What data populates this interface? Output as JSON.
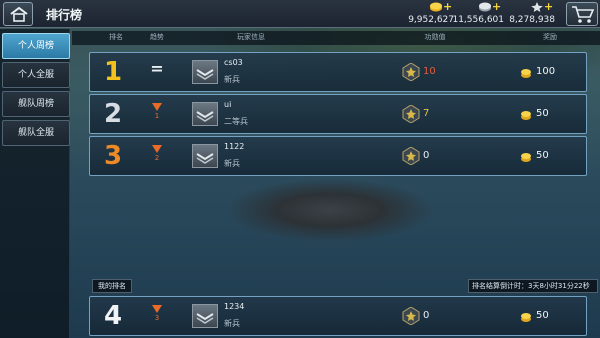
{
  "header": {
    "title": "排行榜",
    "home_icon": "home-icon",
    "shop_icon": "shopping-cart-icon"
  },
  "currencies": [
    {
      "icon": "gold-coins-icon",
      "value": "9,952,627"
    },
    {
      "icon": "silver-coins-icon",
      "value": "11,556,601"
    },
    {
      "icon": "star-icon",
      "value": "8,278,938"
    }
  ],
  "sidebar": {
    "tabs": [
      {
        "label": "个人周榜",
        "active": true
      },
      {
        "label": "个人全服",
        "active": false
      },
      {
        "label": "舰队周榜",
        "active": false
      },
      {
        "label": "舰队全服",
        "active": false
      }
    ]
  },
  "columns": {
    "rank": "排名",
    "trend": "趋势",
    "player": "玩家信息",
    "exploit": "功勋值",
    "reward": "奖励"
  },
  "rows": [
    {
      "rank": "1",
      "trend": "=",
      "trend_num": "",
      "name": "cs03",
      "title": "新兵",
      "exploit": "10",
      "reward": "100"
    },
    {
      "rank": "2",
      "trend": "down",
      "trend_num": "1",
      "name": "ui",
      "title": "二等兵",
      "exploit": "7",
      "reward": "50"
    },
    {
      "rank": "3",
      "trend": "down",
      "trend_num": "2",
      "name": "1122",
      "title": "新兵",
      "exploit": "0",
      "reward": "50"
    }
  ],
  "my_rank": {
    "label": "我的排名",
    "countdown": "排名结算倒计时：3天8小时31分22秒",
    "row": {
      "rank": "4",
      "trend": "down",
      "trend_num": "3",
      "name": "1234",
      "title": "新兵",
      "exploit": "0",
      "reward": "50"
    }
  },
  "colors": {
    "rank1": "#f3c11c",
    "rank2": "#d7dde2",
    "rank3": "#ec8a28",
    "exploit_top": "#e25a3a",
    "exploit_mid": "#e7c63b",
    "trend_down": "#e86b26",
    "active_tab": "#3e95c2"
  }
}
